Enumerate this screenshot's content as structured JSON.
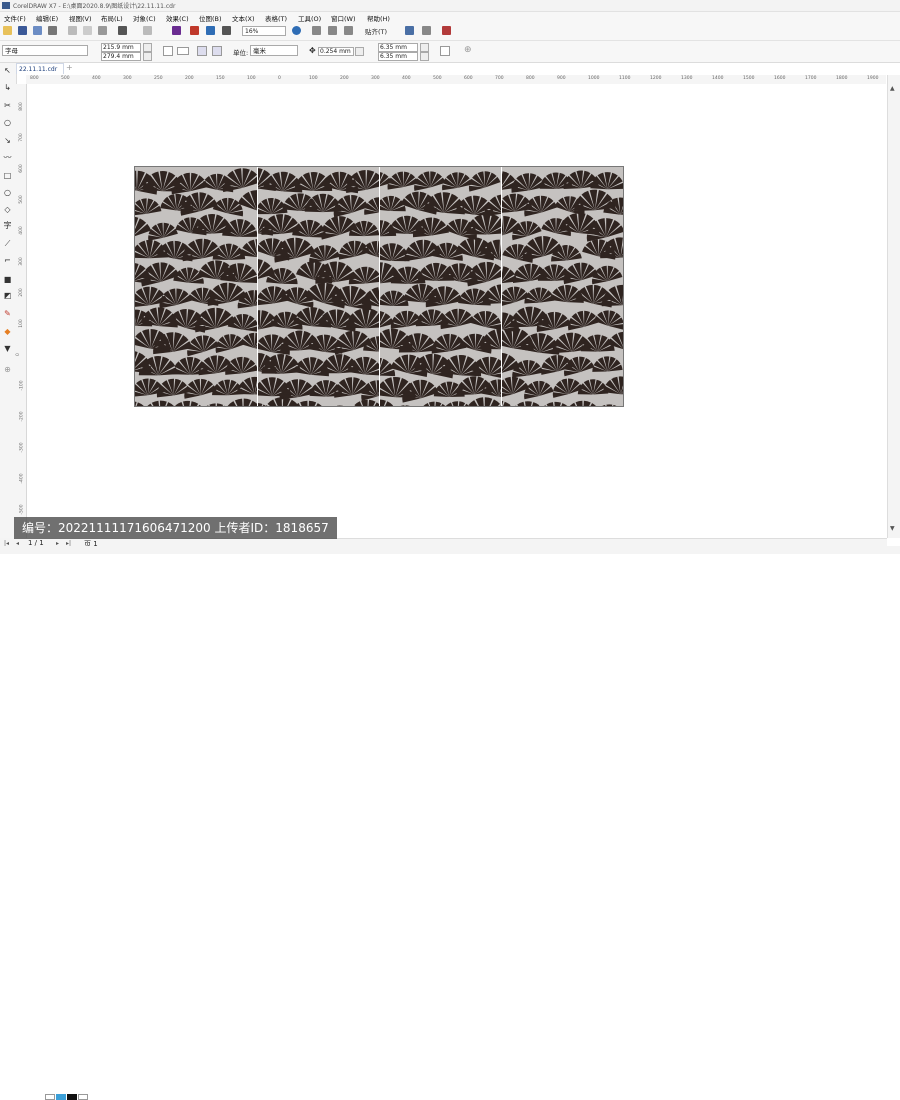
{
  "window": {
    "title": "CorelDRAW X7 - E:\\桌面2020.8.9\\图纸设计\\22.11.11.cdr"
  },
  "menu": [
    "文件(F)",
    "编辑(E)",
    "视图(V)",
    "布局(L)",
    "对象(C)",
    "效果(C)",
    "位图(B)",
    "文本(X)",
    "表格(T)",
    "工具(O)",
    "窗口(W)",
    "帮助(H)"
  ],
  "toolbar": {
    "zoom": "16%",
    "snap_label": "贴齐(T)"
  },
  "propbar": {
    "object_type": "字母",
    "width": "215.9 mm",
    "height": "279.4 mm",
    "unit_label": "单位:",
    "unit": "毫米",
    "nudge": "0.254 mm",
    "dup_x": "6.35 mm",
    "dup_y": "6.35 mm"
  },
  "doc_tab": "22.11.11.cdr",
  "ruler": {
    "h_ticks": [
      "800",
      "500",
      "400",
      "300",
      "250",
      "200",
      "150",
      "100",
      "0",
      "100",
      "200",
      "300",
      "400",
      "500",
      "600",
      "700",
      "800",
      "900",
      "1000",
      "1100",
      "1200",
      "1300",
      "1400",
      "1500",
      "1600",
      "1700",
      "1800",
      "1900"
    ],
    "v_ticks": [
      "800",
      "700",
      "600",
      "500",
      "400",
      "300",
      "200",
      "100",
      "0",
      "-100",
      "-200",
      "-300",
      "-400",
      "-500"
    ]
  },
  "pager": {
    "current": "1 / 1",
    "page_tab": "页 1"
  },
  "watermark": "编号：20221111171606471200 上传者ID：1818657",
  "colors": {
    "panel_bg": "#c5c2c0",
    "pattern": "#2f2420",
    "accent": "#3a5a8c"
  }
}
